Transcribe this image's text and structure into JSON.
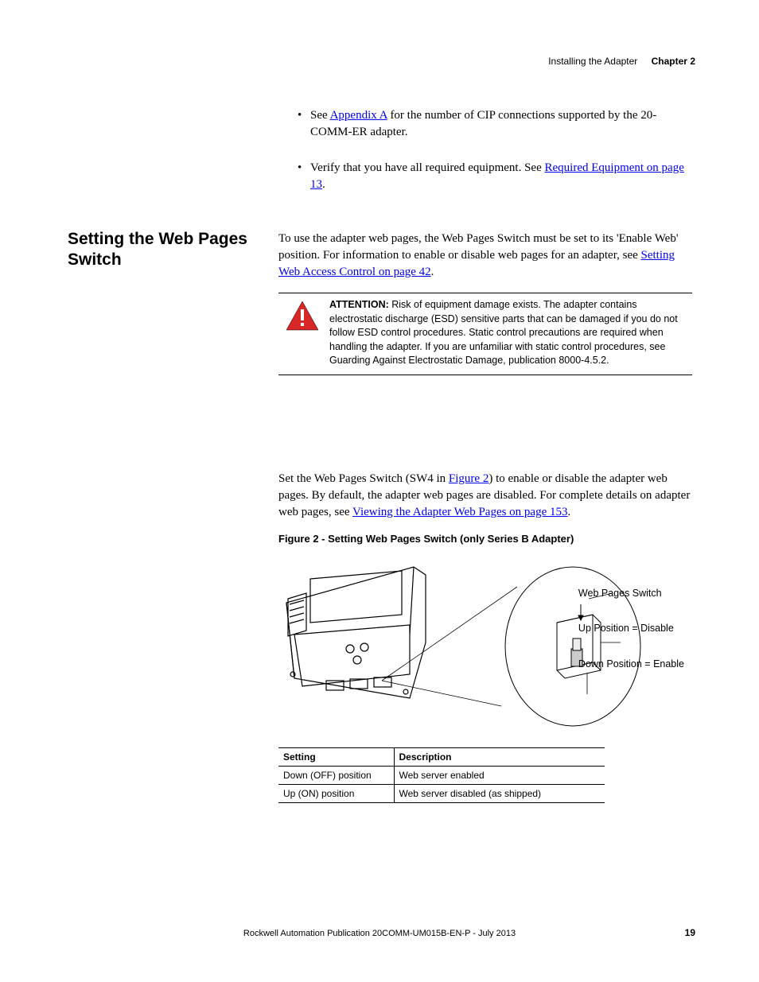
{
  "header": {
    "section": "Installing the Adapter",
    "chapter": "Chapter 2"
  },
  "bullets": [
    {
      "prefix": "See ",
      "link": "Appendix A",
      "suffix": " for the number of CIP connections supported by the 20-COMM-ER adapter."
    },
    {
      "prefix": "Verify that you have all required equipment. See ",
      "link": "Required Equipment on page 13",
      "suffix": "."
    }
  ],
  "section_heading": "Setting the Web Pages Switch",
  "intro": {
    "part1": "To use the adapter web pages, the Web Pages Switch must be set to its 'Enable Web' position. For information to enable or disable web pages for an adapter, see ",
    "link": "Setting Web Access Control on page 42",
    "part2": "."
  },
  "attention": {
    "label": "ATTENTION:",
    "text": " Risk of equipment damage exists. The adapter contains electrostatic discharge (ESD) sensitive parts that can be damaged if you do not follow ESD control procedures. Static control precautions are required when handling the adapter. If you are unfamiliar with static control procedures, see Guarding Against Electrostatic Damage, publication 8000-4.5.2."
  },
  "mid_para": {
    "part1": "Set the Web Pages Switch (SW4 in ",
    "link1": "Figure 2",
    "part2": ") to enable or disable the adapter web pages. By default, the adapter web pages are disabled. For complete details on adapter web pages, see ",
    "link2": "Viewing the Adapter Web Pages on page 153",
    "part3": "."
  },
  "figure_caption": "Figure 2 - Setting Web Pages Switch (only Series B Adapter)",
  "figure_labels": {
    "title": "Web Pages Switch",
    "up": "Up Position = Disable",
    "down": "Down Position = Enable"
  },
  "table": {
    "headers": [
      "Setting",
      "Description"
    ],
    "rows": [
      [
        "Down (OFF) position",
        "Web server enabled"
      ],
      [
        "Up (ON) position",
        "Web server disabled (as shipped)"
      ]
    ]
  },
  "footer": "Rockwell Automation Publication  20COMM-UM015B-EN-P - July 2013",
  "page_number": "19"
}
